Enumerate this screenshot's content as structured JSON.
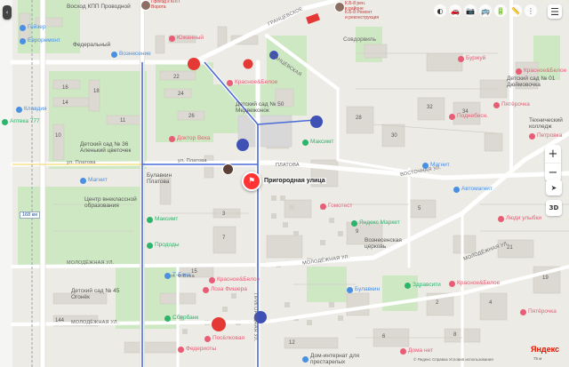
{
  "map": {
    "selected_place": "Пригородная улица",
    "brand": "Яндекс",
    "copyright": "© Яндекс   Справка   Условия использования",
    "scale": "75 м",
    "layer_badge": "3D",
    "left_button": "‹"
  },
  "controls": {
    "zoom_in": "+",
    "zoom_out": "−",
    "locate": "➤",
    "menu": "☰",
    "top_icons": [
      "◐",
      "🚗",
      "📷",
      "🚌",
      "🔋",
      "📏",
      "⋮"
    ]
  },
  "warnings": [
    {
      "line1": "Проезд к КПП",
      "line2": "Ворота"
    },
    {
      "line1": "К.Б-8 рен.",
      "line2": "в районе"
    },
    {
      "line1": "К.Б-8 Ремонт",
      "line2": "и реконструкция"
    }
  ],
  "streets": [
    {
      "name": "ГРАНЦЕВСКОЕ"
    },
    {
      "name": "ул. Платова"
    },
    {
      "name": "ул. Платова"
    },
    {
      "name": "МОЛОДЁЖНАЯ УЛ."
    },
    {
      "name": "МОЛОДЁЖНАЯ УЛ."
    },
    {
      "name": "МОЛОДЁЖНАЯ УЛ."
    },
    {
      "name": "ПРИГОРОДНАЯ УЛ."
    },
    {
      "name": "ВОСТОЧНАЯ УЛ."
    },
    {
      "name": "ПЛАТОВА"
    },
    {
      "name": "ГРАНЦЕВСКАЯ"
    },
    {
      "name": "МОЛОДЁЖНАЯ УЛ."
    },
    {
      "name": "ул. Ф.Бека"
    }
  ],
  "pois": [
    {
      "name": "Гейзер",
      "color": "#4a90e2"
    },
    {
      "name": "Евроремонт",
      "color": "#4a90e2"
    },
    {
      "name": "Клавдия",
      "color": "#4a90e2"
    },
    {
      "name": "Аптека 777",
      "color": "#2db46c"
    },
    {
      "name": "Южанный",
      "color": "#e85d75"
    },
    {
      "name": "Вознесение",
      "color": "#4a90e2"
    },
    {
      "name": "Красное&Белое",
      "color": "#e85d75"
    },
    {
      "name": "Доктор Веха",
      "color": "#e85d75"
    },
    {
      "name": "Детский сад № 36 Аленький цветочек",
      "color": "#4a90e2"
    },
    {
      "name": "Детский сад № 50 Медвежонок",
      "color": "#4a90e2"
    },
    {
      "name": "Магнит",
      "color": "#4a90e2"
    },
    {
      "name": "Булавкин Платова",
      "color": "#4a90e2"
    },
    {
      "name": "Центр внеклассной образования",
      "color": "#4a90e2"
    },
    {
      "name": "Максимт",
      "color": "#2db46c"
    },
    {
      "name": "Максимт",
      "color": "#2db46c"
    },
    {
      "name": "Прододы",
      "color": "#2db46c"
    },
    {
      "name": "Пятёрочка",
      "color": "#e85d75"
    },
    {
      "name": "Петровка",
      "color": "#e85d75"
    },
    {
      "name": "Технический колледж",
      "color": "#4a90e2"
    },
    {
      "name": "Магнит",
      "color": "#4a90e2"
    },
    {
      "name": "Автомагнит",
      "color": "#4a90e2"
    },
    {
      "name": "Гомотест",
      "color": "#e85d75"
    },
    {
      "name": "Яндекс Маркет",
      "color": "#2db46c"
    },
    {
      "name": "Вознесенская церковь",
      "color": "#4a90e2"
    },
    {
      "name": "Здравсити",
      "color": "#2db46c"
    },
    {
      "name": "Булавкин",
      "color": "#4a90e2"
    },
    {
      "name": "Люди улыбки",
      "color": "#e85d75"
    },
    {
      "name": "Красное&Белое",
      "color": "#e85d75"
    },
    {
      "name": "Красное&Белое",
      "color": "#e85d75"
    },
    {
      "name": "Лоза Фишера",
      "color": "#e85d75"
    },
    {
      "name": "Детский сад № 45 Огонёк",
      "color": "#4a90e2"
    },
    {
      "name": "Т-Беке",
      "color": "#4a90e2"
    },
    {
      "name": "Сбербанк",
      "color": "#2db46c"
    },
    {
      "name": "Федериоты",
      "color": "#e85d75"
    },
    {
      "name": "Посёлковая",
      "color": "#e85d75"
    },
    {
      "name": "Дом-интернат для престарелых",
      "color": "#4a90e2"
    },
    {
      "name": "Дома нет",
      "color": "#e85d75"
    },
    {
      "name": "Пятёрочка",
      "color": "#e85d75"
    },
    {
      "name": "Красное&Белое",
      "color": "#e85d75"
    },
    {
      "name": "Поднебесн.",
      "color": "#e85d75"
    },
    {
      "name": "Совдорвиль",
      "color": "#4a90e2"
    },
    {
      "name": "Детский сад № 01 Дюймовочка",
      "color": "#4a90e2"
    },
    {
      "name": "Буржуй",
      "color": "#e85d75"
    },
    {
      "name": "Восход КПП Проводной",
      "color": "#4a90e2"
    },
    {
      "name": "Федеральный",
      "color": "#4a90e2"
    }
  ],
  "labels": [
    {
      "text": "16"
    },
    {
      "text": "18"
    },
    {
      "text": "22"
    },
    {
      "text": "24"
    },
    {
      "text": "26"
    },
    {
      "text": "14"
    },
    {
      "text": "10"
    },
    {
      "text": "11"
    },
    {
      "text": "3"
    },
    {
      "text": "7"
    },
    {
      "text": "15"
    },
    {
      "text": "28"
    },
    {
      "text": "30"
    },
    {
      "text": "32"
    },
    {
      "text": "34"
    },
    {
      "text": "9"
    },
    {
      "text": "5"
    },
    {
      "text": "21"
    },
    {
      "text": "19"
    },
    {
      "text": "144"
    },
    {
      "text": "2"
    },
    {
      "text": "4"
    },
    {
      "text": "6"
    },
    {
      "text": "8"
    },
    {
      "text": "12"
    }
  ],
  "road_badge": "168 км"
}
